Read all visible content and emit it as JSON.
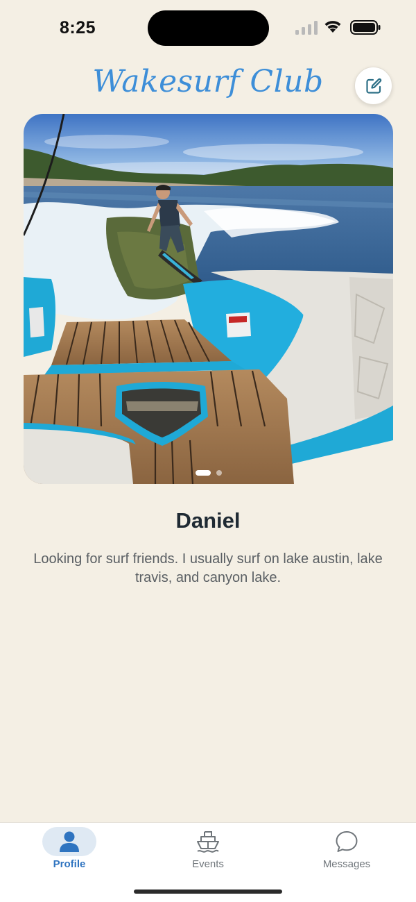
{
  "status_bar": {
    "time": "8:25",
    "icons": [
      "cellular-signal-icon",
      "wifi-icon",
      "battery-icon"
    ]
  },
  "header": {
    "title": "Wakesurf Club",
    "edit_icon": "edit-square-icon"
  },
  "carousel": {
    "page_count": 2,
    "current_page": 1
  },
  "profile": {
    "name": "Daniel",
    "bio": "Looking for surf friends. I usually surf on lake austin, lake travis, and canyon lake."
  },
  "tab_bar": {
    "tabs": [
      {
        "label": "Profile",
        "icon": "person-icon",
        "selected": true
      },
      {
        "label": "Events",
        "icon": "boat-icon",
        "selected": false
      },
      {
        "label": "Messages",
        "icon": "chat-bubble-icon",
        "selected": false
      }
    ]
  },
  "colors": {
    "background": "#f4efe4",
    "accent": "#2f74c0",
    "title": "#3d8ed8",
    "selected_tab_pill": "#dfe9f3"
  }
}
